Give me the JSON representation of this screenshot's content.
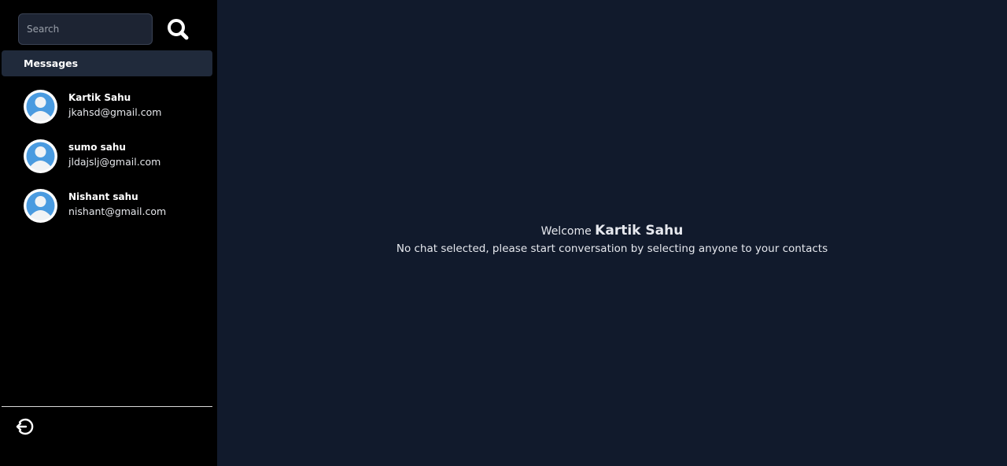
{
  "search": {
    "placeholder": "Search",
    "value": ""
  },
  "icons": {
    "search": "search-icon",
    "logout": "logout-icon",
    "avatar": "user-avatar-icon"
  },
  "sidebar": {
    "title": "Messages",
    "contacts": [
      {
        "name": "Kartik Sahu",
        "email": "jkahsd@gmail.com"
      },
      {
        "name": "sumo sahu",
        "email": "jldajslj@gmail.com"
      },
      {
        "name": "Nishant sahu",
        "email": "nishant@gmail.com"
      }
    ]
  },
  "main": {
    "welcome_prefix": "Welcome",
    "user_name": "Kartik Sahu",
    "empty_message": "No chat selected, please start conversation by selecting anyone to your contacts"
  },
  "colors": {
    "sidebar_bg": "#000000",
    "main_bg": "#111a2c",
    "header_bg": "#202a3b",
    "avatar_blue": "#4a9be0"
  }
}
